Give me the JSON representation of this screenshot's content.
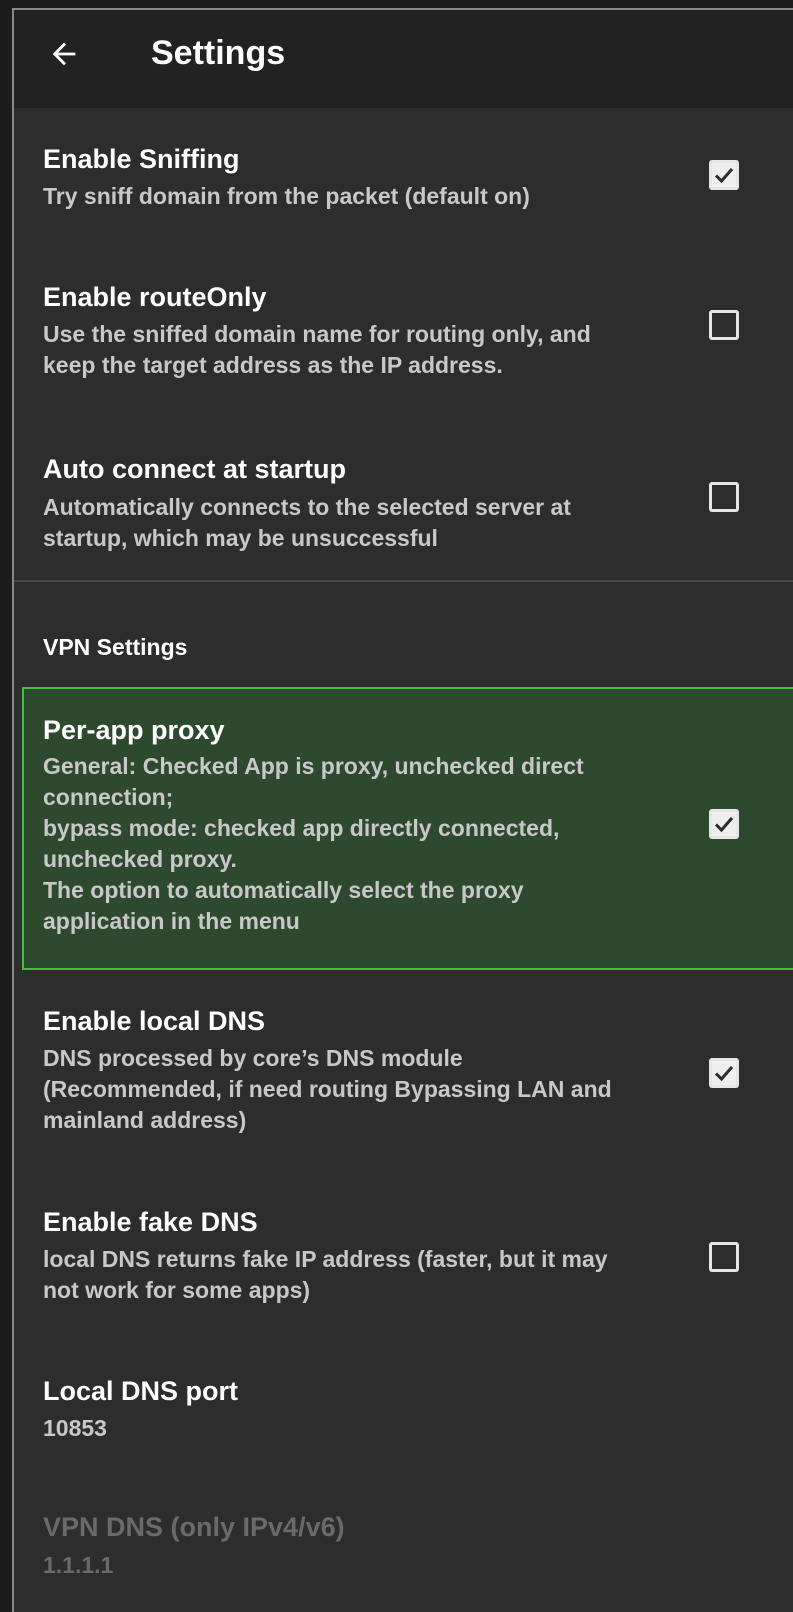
{
  "appbar": {
    "title": "Settings",
    "back_icon": "arrow-left-icon"
  },
  "prefs": {
    "sniffing": {
      "title": "Enable Sniffing",
      "summary": "Try sniff domain from the packet (default on)",
      "checked": true
    },
    "route_only": {
      "title": "Enable routeOnly",
      "summary": "Use the sniffed domain name for routing only, and\nkeep the target address as the IP address.",
      "checked": false
    },
    "auto_connect": {
      "title": "Auto connect at startup",
      "summary": "Automatically connects to the selected server at\nstartup, which may be unsuccessful",
      "checked": false
    },
    "vpn_category": {
      "title": "VPN Settings"
    },
    "per_app_proxy": {
      "title": "Per-app proxy",
      "summary": "General: Checked App is proxy, unchecked direct\nconnection;\nbypass mode: checked app directly connected,\nunchecked proxy.\nThe option to automatically select the proxy\napplication in the menu",
      "checked": true
    },
    "local_dns": {
      "title": "Enable local DNS",
      "summary": "DNS processed by core’s DNS module\n(Recommended, if need routing Bypassing LAN and\nmainland address)",
      "checked": true
    },
    "fake_dns": {
      "title": "Enable fake DNS",
      "summary": "local DNS returns fake IP address (faster, but it may\nnot work for some apps)",
      "checked": false
    },
    "local_dns_port": {
      "title": "Local DNS port",
      "value": "10853"
    },
    "vpn_dns": {
      "title": "VPN DNS (only IPv4/v6)",
      "value": "1.1.1.1"
    }
  },
  "colors": {
    "background": "#2d2d2d",
    "appbar": "#222222",
    "highlight_fill": "#2e4a2e",
    "highlight_border": "#3cc23c"
  }
}
